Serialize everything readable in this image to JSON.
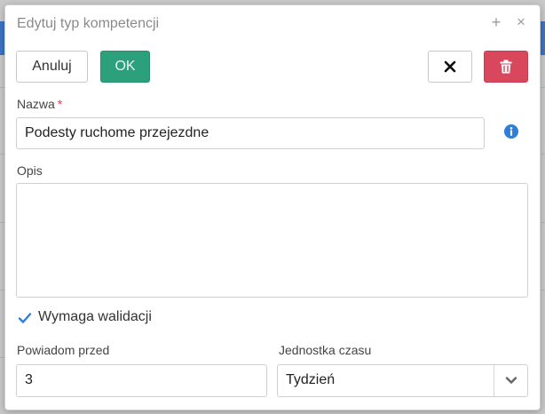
{
  "dialog": {
    "title": "Edytuj typ kompetencji",
    "plus_symbol": "+",
    "close_symbol": "×"
  },
  "toolbar": {
    "cancel_label": "Anuluj",
    "ok_label": "OK",
    "x_icon": "close-x-icon",
    "delete_icon": "trash-icon"
  },
  "form": {
    "name_label": "Nazwa",
    "required_mark": "*",
    "name_value": "Podesty ruchome przejezdne",
    "description_label": "Opis",
    "description_value": "",
    "validation_label": "Wymaga walidacji",
    "validation_checked": true,
    "notify_label": "Powiadom przed",
    "notify_value": "3",
    "unit_label": "Jednostka czasu",
    "unit_value": "Tydzień"
  },
  "colors": {
    "ok": "#2ca07a",
    "delete": "#d9475c",
    "info": "#2f7ed8",
    "check": "#2f7ed8"
  }
}
